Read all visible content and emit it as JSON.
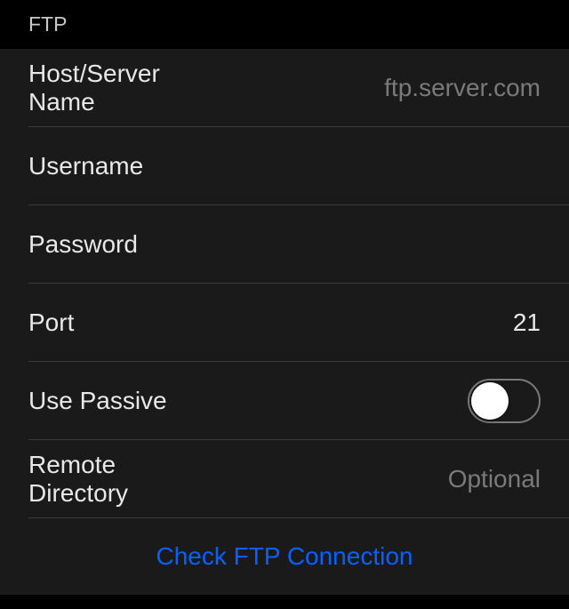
{
  "section": {
    "title": "FTP"
  },
  "fields": {
    "host": {
      "label": "Host/Server Name",
      "placeholder": "ftp.server.com",
      "value": ""
    },
    "username": {
      "label": "Username",
      "value": ""
    },
    "password": {
      "label": "Password",
      "value": ""
    },
    "port": {
      "label": "Port",
      "value": "21"
    },
    "passive": {
      "label": "Use Passive",
      "enabled": false
    },
    "remote_dir": {
      "label": "Remote Directory",
      "placeholder": "Optional",
      "value": ""
    }
  },
  "action": {
    "check_connection": "Check FTP Connection"
  }
}
